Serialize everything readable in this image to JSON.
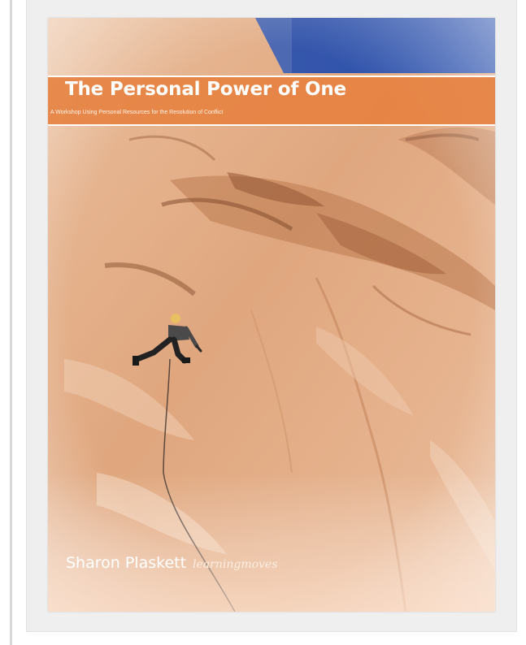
{
  "cover": {
    "title": "The Personal Power of One",
    "subtitle": "A Workshop Using Personal Resources for the Resolution of Conflict",
    "author": "Sharon Plaskett",
    "brand": "learningmoves"
  },
  "colors": {
    "title_band": "#e67f3e",
    "sky": "#1f4fb8",
    "rock": "#e8b18b"
  }
}
